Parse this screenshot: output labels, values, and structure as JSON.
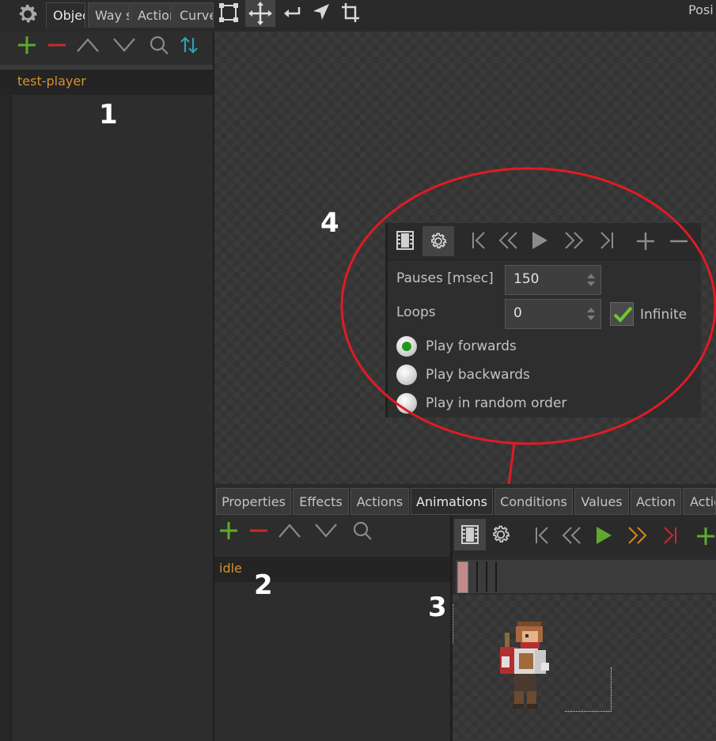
{
  "top_tabs": [
    "Objec",
    "Way s",
    "Actior",
    "Curves"
  ],
  "top_right_label": "Posi",
  "left_panel": {
    "items": [
      "test-player"
    ]
  },
  "bottom_tabs": [
    "Properties",
    "Effects",
    "Actions",
    "Animations",
    "Conditions",
    "Values",
    "Action",
    "Actio"
  ],
  "animations_panel": {
    "items": [
      "idle"
    ]
  },
  "popup": {
    "pauses_label": "Pauses [msec]",
    "pauses_value": "150",
    "loops_label": "Loops",
    "loops_value": "0",
    "infinite_label": "Infinite",
    "infinite_checked": true,
    "radio_options": [
      "Play forwards",
      "Play backwards",
      "Play in random order"
    ],
    "selected_option": "Play forwards"
  },
  "annotations": {
    "n1": "1",
    "n2": "2",
    "n3": "3",
    "n4": "4"
  },
  "colors": {
    "accent_orange": "#d7922f",
    "green": "#5faa2e",
    "red": "#c62c2c",
    "annotation_red": "#e01b24",
    "teal": "#2aa2b3"
  }
}
